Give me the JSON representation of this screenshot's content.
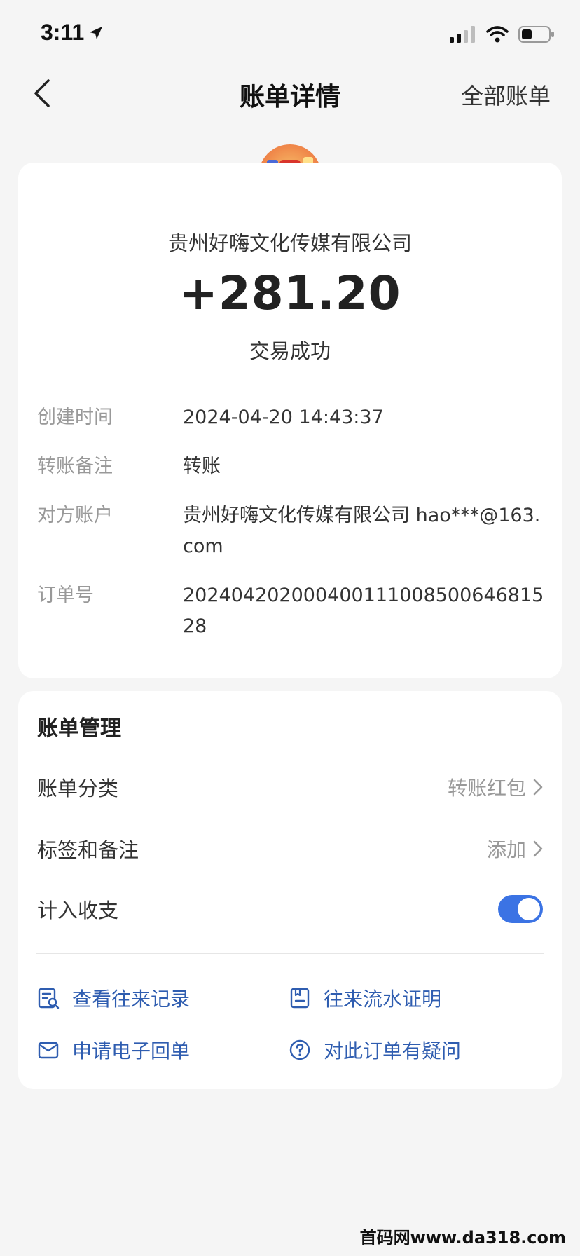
{
  "status_bar": {
    "time": "3:11"
  },
  "nav": {
    "title": "账单详情",
    "right_link": "全部账单"
  },
  "bill": {
    "company": "贵州好嗨文化传媒有限公司",
    "amount": "+281.20",
    "status": "交易成功",
    "details": [
      {
        "label": "创建时间",
        "value": "2024-04-20 14:43:37"
      },
      {
        "label": "转账备注",
        "value": "转账"
      },
      {
        "label": "对方账户",
        "value": "贵州好嗨文化传媒有限公司 hao***@163.com"
      },
      {
        "label": "订单号",
        "value": "20240420200040011100850064681528"
      }
    ]
  },
  "manage": {
    "title": "账单管理",
    "category": {
      "label": "账单分类",
      "value": "转账红包"
    },
    "tags": {
      "label": "标签和备注",
      "value": "添加"
    },
    "count_in": {
      "label": "计入收支",
      "enabled": true
    },
    "actions": [
      {
        "label": "查看往来记录",
        "icon": "records-icon"
      },
      {
        "label": "往来流水证明",
        "icon": "statement-icon"
      },
      {
        "label": "申请电子回单",
        "icon": "mail-icon"
      },
      {
        "label": "对此订单有疑问",
        "icon": "question-icon"
      }
    ]
  },
  "watermark": "首码网www.da318.com",
  "colors": {
    "accent": "#3b73e4",
    "link": "#2f5db0",
    "background": "#f5f5f5"
  }
}
